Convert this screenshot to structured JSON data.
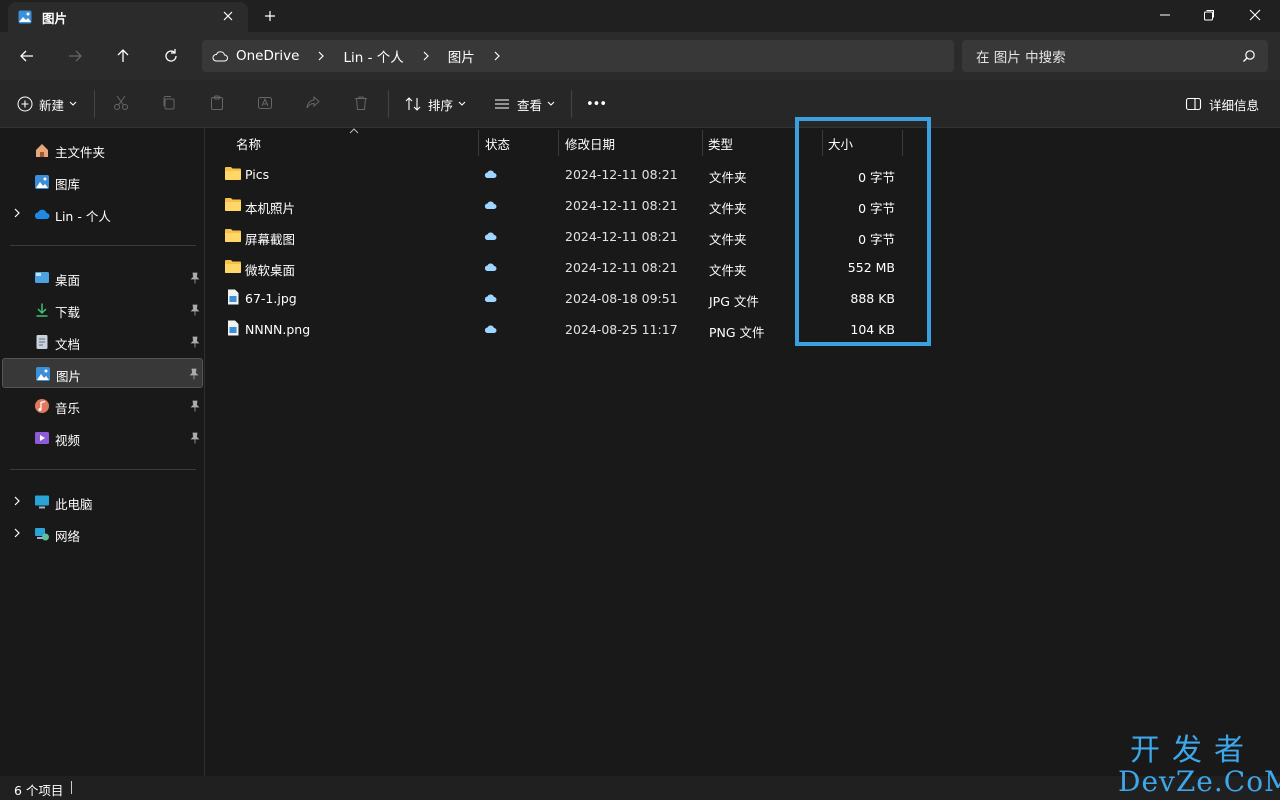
{
  "window": {
    "tab_title": "图片"
  },
  "breadcrumb": [
    "OneDrive",
    "Lin - 个人",
    "图片"
  ],
  "search": {
    "placeholder": "在 图片 中搜索"
  },
  "toolbar": {
    "new_label": "新建",
    "sort_label": "排序",
    "view_label": "查看",
    "more_label": "•••",
    "details_label": "详细信息"
  },
  "sidebar": {
    "top": [
      {
        "label": "主文件夹",
        "icon": "home-icon"
      },
      {
        "label": "图库",
        "icon": "gallery-icon"
      },
      {
        "label": "Lin - 个人",
        "icon": "onedrive-cloud-icon"
      }
    ],
    "pinned": [
      {
        "label": "桌面",
        "icon": "desktop-icon"
      },
      {
        "label": "下载",
        "icon": "download-icon"
      },
      {
        "label": "文档",
        "icon": "documents-icon"
      },
      {
        "label": "图片",
        "icon": "pictures-icon",
        "selected": true
      },
      {
        "label": "音乐",
        "icon": "music-icon"
      },
      {
        "label": "视频",
        "icon": "video-icon"
      }
    ],
    "bottom": [
      {
        "label": "此电脑",
        "icon": "computer-icon"
      },
      {
        "label": "网络",
        "icon": "network-icon"
      }
    ]
  },
  "columns": {
    "name": "名称",
    "status": "状态",
    "modified": "修改日期",
    "type": "类型",
    "size": "大小"
  },
  "files": [
    {
      "name": "Pics",
      "date": "2024-12-11 08:21",
      "type": "文件夹",
      "size": "0 字节",
      "kind": "folder"
    },
    {
      "name": "本机照片",
      "date": "2024-12-11 08:21",
      "type": "文件夹",
      "size": "0 字节",
      "kind": "folder"
    },
    {
      "name": "屏幕截图",
      "date": "2024-12-11 08:21",
      "type": "文件夹",
      "size": "0 字节",
      "kind": "folder"
    },
    {
      "name": "微软桌面",
      "date": "2024-12-11 08:21",
      "type": "文件夹",
      "size": "552 MB",
      "kind": "folder"
    },
    {
      "name": "67-1.jpg",
      "date": "2024-08-18 09:51",
      "type": "JPG 文件",
      "size": "888 KB",
      "kind": "image"
    },
    {
      "name": "NNNN.png",
      "date": "2024-08-25 11:17",
      "type": "PNG 文件",
      "size": "104 KB",
      "kind": "image"
    }
  ],
  "status": {
    "item_count": "6 个项目"
  },
  "watermark": {
    "line1": "开发者",
    "line2": "DevZe.CoM"
  },
  "colors": {
    "folder": "#f5c14a",
    "accent": "#3aa0e0",
    "cloud": "#9fd6ff"
  }
}
